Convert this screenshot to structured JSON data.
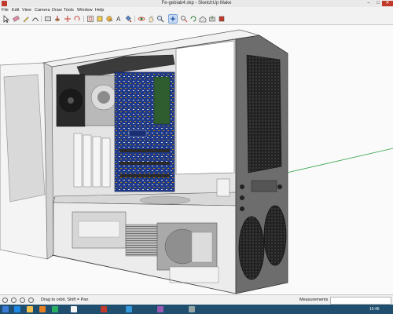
{
  "window": {
    "title": "Fe-gebiab4.skp - SketchUp Make",
    "minimize_glyph": "–",
    "maximize_glyph": "□",
    "close_glyph": "✕"
  },
  "menu": [
    "File",
    "Edit",
    "View",
    "Camera",
    "Draw",
    "Tools",
    "Window",
    "Help"
  ],
  "toolbar": {
    "icons": [
      "select-icon",
      "eraser-icon",
      "pencil-icon",
      "rectangle-icon",
      "circle-icon",
      "push-pull-icon",
      "move-icon",
      "rotate-icon",
      "scale-icon",
      "offset-icon",
      "tape-measure-icon",
      "text-icon",
      "paint-bucket-icon",
      "orbit-icon",
      "pan-icon",
      "zoom-icon",
      "zoom-extents-icon",
      "warehouse-icon",
      "extension-warehouse-icon",
      "layout-icon",
      "styles-icon",
      "section-icon"
    ]
  },
  "status": {
    "hint": "Drag to orbit. Shift = Pan",
    "measurements_label": "Measurements",
    "measurements_value": ""
  },
  "taskbar": {
    "clock": "15:46",
    "icons": [
      "start-icon",
      "ie-icon",
      "explorer-icon",
      "media-icon",
      "store-icon",
      "chrome-icon",
      "sketchup-icon",
      "mail-icon",
      "photos-icon",
      "calc-icon"
    ]
  },
  "colors": {
    "accent": "#c0392b",
    "taskbar": "#1f4e6e",
    "axis_green": "#2ea043"
  }
}
